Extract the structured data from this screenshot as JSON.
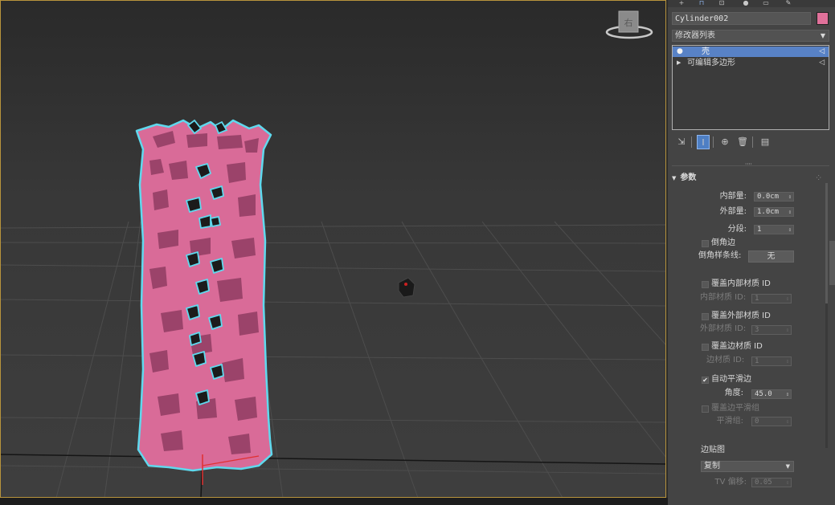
{
  "viewport": {
    "viewcube_label": "右"
  },
  "panel": {
    "tab_icons": [
      "+",
      "⊓",
      "⊡",
      "●",
      "▭",
      "✎"
    ],
    "object_name": "Cylinder002",
    "object_color": "#e0719a",
    "modifier_list_label": "修改器列表",
    "modifier_list_arrow": "▼",
    "stack": [
      {
        "prefix": "●",
        "label": "壳",
        "pin": "◁",
        "selected": true
      },
      {
        "prefix": "▶",
        "label": "可编辑多边形",
        "pin": "◁",
        "selected": false
      }
    ],
    "tools": [
      "⇲",
      "I",
      "⊕",
      "🗑",
      "▤"
    ],
    "grip": "''''",
    "rollout_title": "参数",
    "rollout_triangle": "▼",
    "rollout_dots": "⁘",
    "params": {
      "inner_amount_label": "内部量:",
      "inner_amount_value": "0.0cm",
      "outer_amount_label": "外部量:",
      "outer_amount_value": "1.0cm",
      "segments_label": "分段:",
      "segments_value": "1",
      "bevel_edges_label": "倒角边",
      "bevel_spline_label": "倒角样条线:",
      "bevel_spline_button": "无",
      "override_inner_mat_label": "覆盖内部材质 ID",
      "inner_mat_id_label": "内部材质 ID:",
      "inner_mat_id_value": "1",
      "override_outer_mat_label": "覆盖外部材质 ID",
      "outer_mat_id_label": "外部材质 ID:",
      "outer_mat_id_value": "3",
      "override_edge_mat_label": "覆盖边材质 ID",
      "edge_mat_id_label": "边材质 ID:",
      "edge_mat_id_value": "1",
      "auto_smooth_label": "自动平滑边",
      "auto_smooth_check": "✔",
      "angle_label": "角度:",
      "angle_value": "45.0",
      "override_edge_smooth_label": "覆盖边平滑组",
      "smooth_group_label": "平滑组:",
      "smooth_group_value": "0",
      "edge_mapping_label": "边贴图",
      "edge_mapping_value": "复制",
      "tv_offset_label": "TV 偏移:",
      "tv_offset_value": "0.05",
      "spin_arrow": "⇕",
      "select_arrow": "▼"
    }
  }
}
